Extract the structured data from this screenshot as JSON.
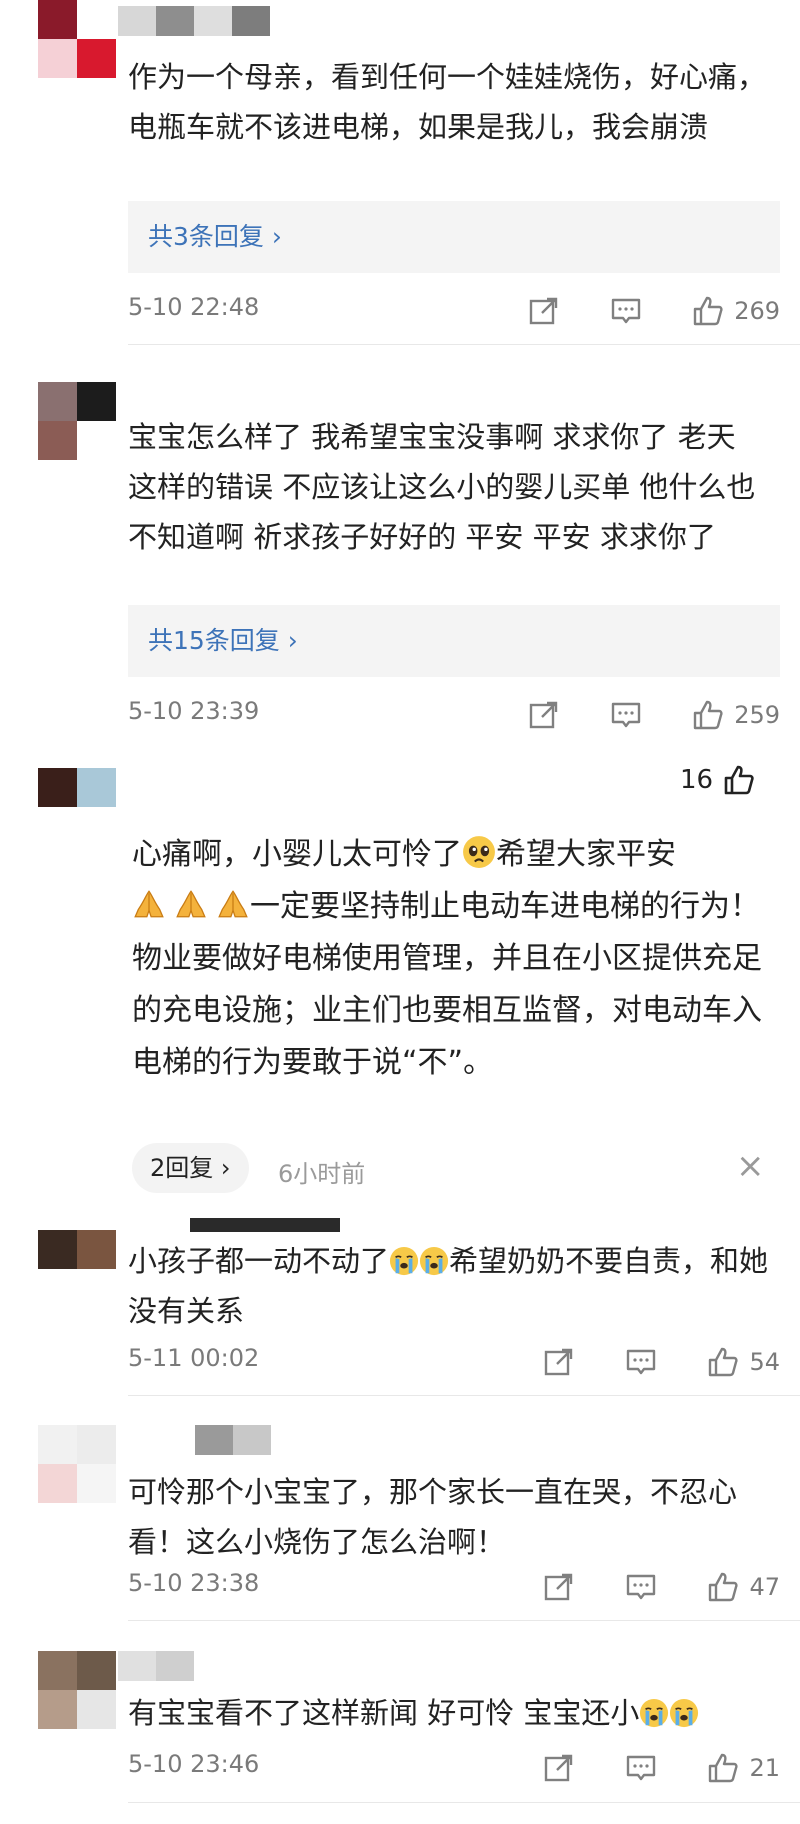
{
  "comments": [
    {
      "text": "作为一个母亲，看到任何一个娃娃烧伤，好心痛，电瓶车就不该进电梯，如果是我儿，我会崩溃",
      "replies": "共3条回复 ›",
      "time": "5-10 22:48",
      "likes": "269"
    },
    {
      "text": "宝宝怎么样了 我希望宝宝没事啊 求求你了 老天 这样的错误 不应该让这么小的婴儿买单 他什么也不知道啊 祈求孩子好好的 平安 平安 求求你了",
      "replies": "共15条回复 ›",
      "time": "5-10 23:39",
      "likes": "259"
    },
    {
      "likes": "16",
      "text_a": "心痛啊，小婴儿太可怜了",
      "text_b": "希望大家平安",
      "text_c": "一定要坚持制止电动车进电梯的行为！物业要做好电梯使用管理，并且在小区提供充足的充电设施；业主们也要相互监督，对电动车入电梯的行为要敢于说“不”。",
      "reply_pill": "2回复 ›",
      "time_ago": "6小时前",
      "close": "×"
    },
    {
      "text_a": "小孩子都一动不动了",
      "text_b": "希望奶奶不要自责，和她没有关系",
      "time": "5-11 00:02",
      "likes": "54"
    },
    {
      "text": "可怜那个小宝宝了，那个家长一直在哭，不忍心看！这么小烧伤了怎么治啊！",
      "time": "5-10 23:38",
      "likes": "47"
    },
    {
      "text_a": "有宝宝看不了这样新闻 好可怜 宝宝还小",
      "time": "5-10 23:46",
      "likes": "21"
    }
  ],
  "icons": {
    "share": "share-icon",
    "comment": "comment-icon",
    "like": "thumbs-up-icon",
    "emoji_pleading": "pleading-face-emoji",
    "emoji_pray": "folded-hands-emoji",
    "emoji_crying": "loudly-crying-face-emoji"
  },
  "colors": {
    "reply_link": "#3d73b8",
    "meta_gray": "#7a7a7a",
    "reply_box_bg": "#f4f4f4"
  }
}
